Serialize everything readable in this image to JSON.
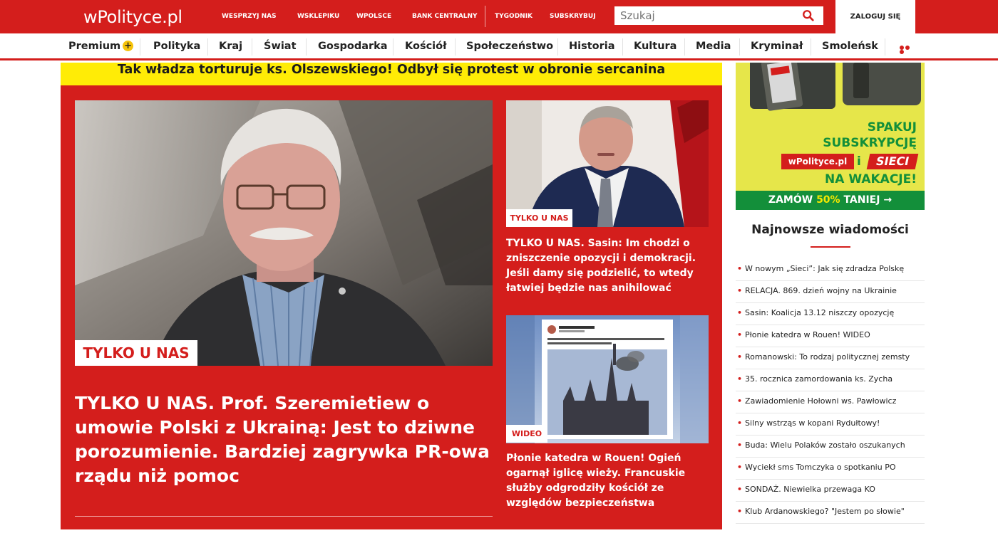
{
  "header": {
    "logo": "wPolityce.pl",
    "links": [
      "WESPRZYJ NAS",
      "WSKLEPIKU",
      "WPOLSCE",
      "BANK CENTRALNY",
      "TYGODNIK",
      "SUBSKRYBUJ"
    ],
    "search_placeholder": "Szukaj",
    "login_label": "ZALOGUJ SIĘ"
  },
  "nav": {
    "items": [
      "Premium",
      "Polityka",
      "Kraj",
      "Świat",
      "Gospodarka",
      "Kościół",
      "Społeczeństwo",
      "Historia",
      "Kultura",
      "Media",
      "Kryminał",
      "Smoleńsk"
    ]
  },
  "banner": {
    "text": "Tak władza torturuje ks. Olszewskiego! Odbył się protest w obronie sercanina"
  },
  "main_story": {
    "tag": "TYLKO U NAS",
    "headline": "TYLKO U NAS. Prof. Szeremietiew o umowie Polski z Ukrainą: Jest to dziwne porozumienie. Bardziej zagrywka PR-owa rządu niż pomoc"
  },
  "side_stories": [
    {
      "tag": "TYLKO U NAS",
      "headline": "TYLKO U NAS. Sasin: Im chodzi o zniszczenie opozycji i demokracji. Jeśli damy się podzielić, to wtedy łatwiej będzie nas anihilować"
    },
    {
      "tag": "WIDEO",
      "headline": "Płonie katedra w Rouen! Ogień ogarnął iglicę wieży. Francuskie służby odgrodziły kościół ze względów bezpieczeństwa"
    }
  ],
  "ad": {
    "line1": "SPAKUJ",
    "line2": "SUBSKRYPCJĘ",
    "brand1": "wPolityce.pl",
    "conj": "i",
    "brand2": "SIECI",
    "line3": "NA WAKACJE!",
    "cta_pre": "ZAMÓW",
    "cta_hl": "50%",
    "cta_post": "TANIEJ →"
  },
  "latest": {
    "title": "Najnowsze wiadomości",
    "items": [
      "W nowym „Sieci”: Jak się zdradza Polskę",
      "RELACJA. 869. dzień wojny na Ukrainie",
      "Sasin: Koalicja 13.12 niszczy opozycję",
      "Płonie katedra w Rouen! WIDEO",
      "Romanowski: To rodzaj politycznej zemsty",
      "35. rocznica zamordowania ks. Zycha",
      "Zawiadomienie Hołowni ws. Pawłowicz",
      "Silny wstrząs w kopani Rydułtowy!",
      "Buda: Wielu Polaków zostało oszukanych",
      "Wyciekł sms Tomczyka o spotkaniu PO",
      "SONDAŻ. Niewielka przewaga KO",
      "Klub Ardanowskiego? \"Jestem po słowie\""
    ]
  },
  "colors": {
    "brand_red": "#d41e1c",
    "banner_yellow": "#ffec06",
    "ad_green": "#138f3a",
    "premium_yellow": "#f5c20a"
  }
}
